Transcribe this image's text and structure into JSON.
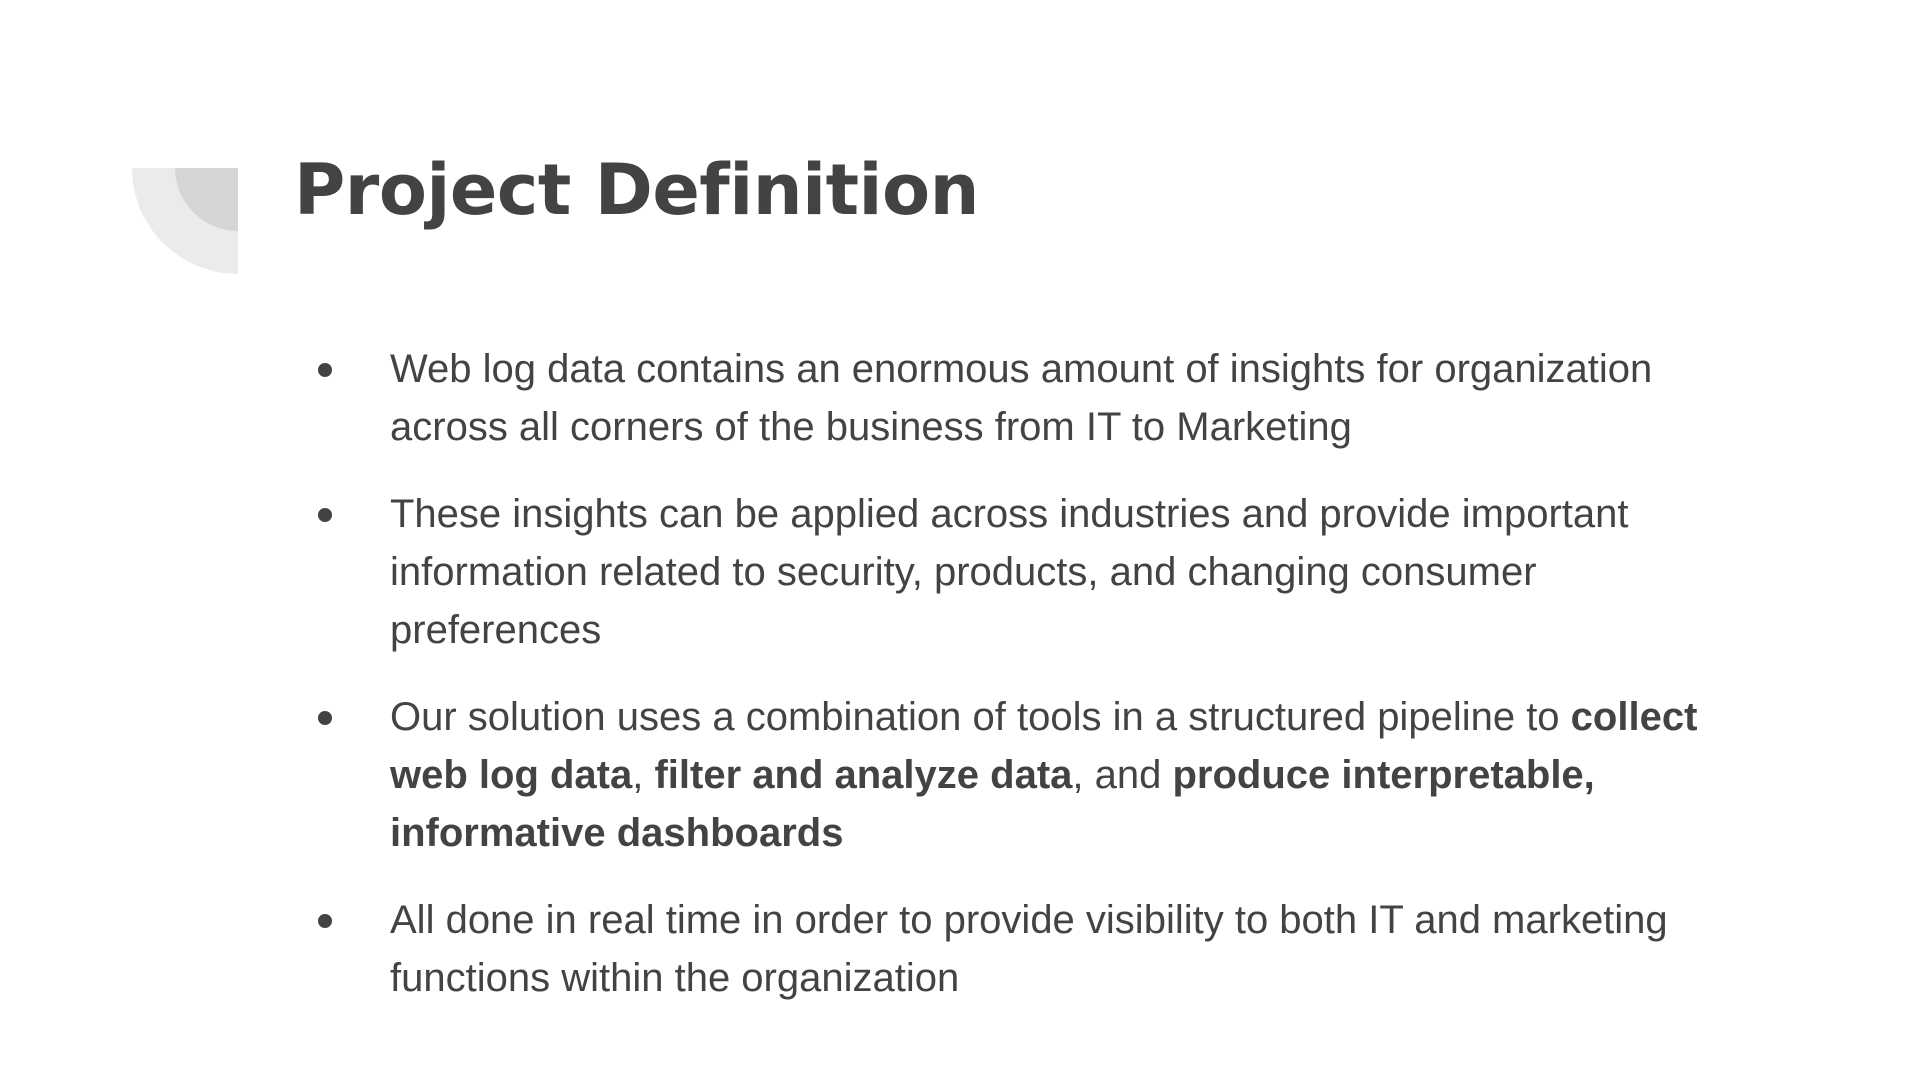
{
  "slide": {
    "title": "Project Definition",
    "colors": {
      "text": "#434343",
      "background": "#ffffff",
      "decoration_light": "#ebebeb",
      "decoration_dark": "#d5d5d5"
    },
    "decoration_icon": "quarter-circle-decoration-icon",
    "bullets": [
      {
        "text": "Web log data contains an enormous amount of insights for organization across all corners of the business from IT to Marketing"
      },
      {
        "text": "These insights can be applied across industries and provide important information related to security, products, and changing consumer preferences"
      },
      {
        "intro": "Our solution uses a combination of tools in a structured pipeline to ",
        "bold1": "collect web log data",
        "sep1": ", ",
        "bold2": "filter and analyze data",
        "sep2": ", and ",
        "bold3": "produce interpretable, informative dashboards"
      },
      {
        "text": "All done in real time in order to provide visibility to both IT and marketing functions within the organization"
      }
    ]
  }
}
